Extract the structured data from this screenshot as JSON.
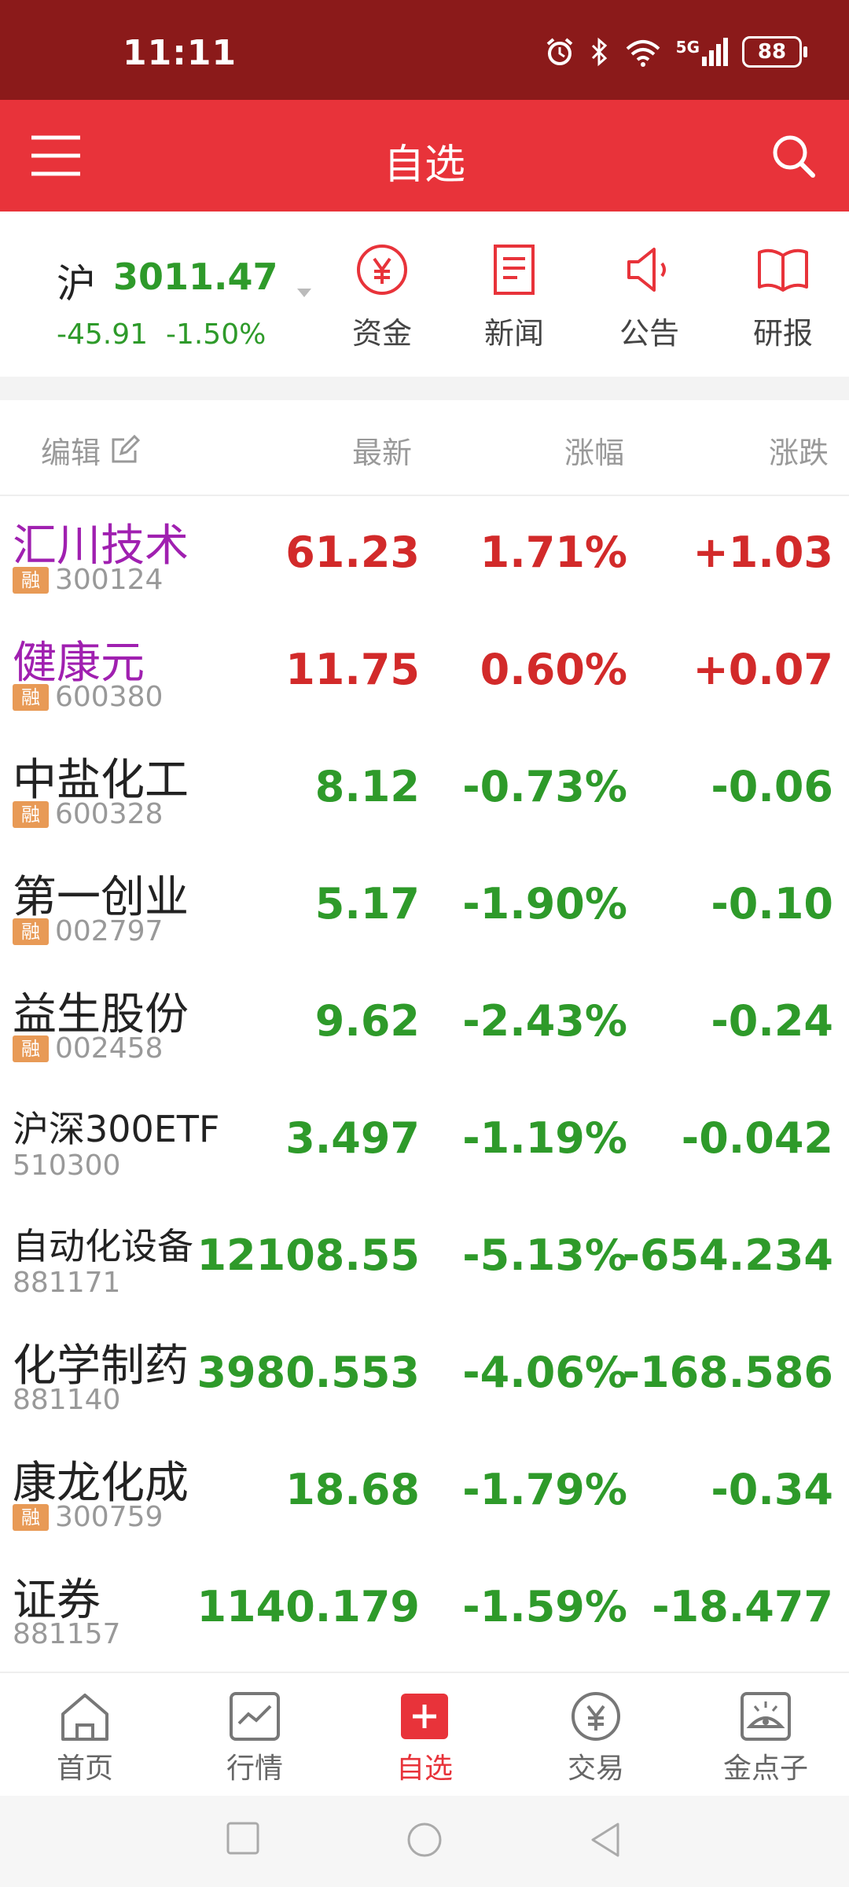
{
  "status_bar": {
    "time": "11:11",
    "battery": "88",
    "network": "5G"
  },
  "nav": {
    "title": "自选"
  },
  "index": {
    "name": "沪",
    "value": "3011.47",
    "change": "-45.91",
    "change_pct": "-1.50%"
  },
  "quick_actions": [
    {
      "label": "资金",
      "icon": "yuan-circle-icon"
    },
    {
      "label": "新闻",
      "icon": "document-icon"
    },
    {
      "label": "公告",
      "icon": "megaphone-icon"
    },
    {
      "label": "研报",
      "icon": "book-icon"
    }
  ],
  "list_header": {
    "edit": "编辑",
    "latest": "最新",
    "pct": "涨幅",
    "change": "涨跌"
  },
  "stocks": [
    {
      "name": "汇川技术",
      "code": "300124",
      "badge": "融",
      "latest": "61.23",
      "pct": "1.71%",
      "change": "+1.03",
      "trend": "up",
      "color": "purple"
    },
    {
      "name": "健康元",
      "code": "600380",
      "badge": "融",
      "latest": "11.75",
      "pct": "0.60%",
      "change": "+0.07",
      "trend": "up",
      "color": "purple"
    },
    {
      "name": "中盐化工",
      "code": "600328",
      "badge": "融",
      "latest": "8.12",
      "pct": "-0.73%",
      "change": "-0.06",
      "trend": "down",
      "color": "normal"
    },
    {
      "name": "第一创业",
      "code": "002797",
      "badge": "融",
      "latest": "5.17",
      "pct": "-1.90%",
      "change": "-0.10",
      "trend": "down",
      "color": "normal"
    },
    {
      "name": "益生股份",
      "code": "002458",
      "badge": "融",
      "latest": "9.62",
      "pct": "-2.43%",
      "change": "-0.24",
      "trend": "down",
      "color": "normal"
    },
    {
      "name": "沪深300ETF",
      "code": "510300",
      "badge": "",
      "latest": "3.497",
      "pct": "-1.19%",
      "change": "-0.042",
      "trend": "down",
      "color": "small"
    },
    {
      "name": "自动化设备",
      "code": "881171",
      "badge": "",
      "latest": "12108.55",
      "pct": "-5.13%",
      "change": "-654.234",
      "trend": "down",
      "color": "small"
    },
    {
      "name": "化学制药",
      "code": "881140",
      "badge": "",
      "latest": "3980.553",
      "pct": "-4.06%",
      "change": "-168.586",
      "trend": "down",
      "color": "normal"
    },
    {
      "name": "康龙化成",
      "code": "300759",
      "badge": "融",
      "latest": "18.68",
      "pct": "-1.79%",
      "change": "-0.34",
      "trend": "down",
      "color": "normal"
    },
    {
      "name": "证券",
      "code": "881157",
      "badge": "",
      "latest": "1140.179",
      "pct": "-1.59%",
      "change": "-18.477",
      "trend": "down",
      "color": "normal"
    }
  ],
  "tabs": [
    {
      "label": "首页",
      "icon": "home-icon"
    },
    {
      "label": "行情",
      "icon": "chart-icon"
    },
    {
      "label": "自选",
      "icon": "plus-square-icon",
      "active": true
    },
    {
      "label": "交易",
      "icon": "yuan-circle-icon"
    },
    {
      "label": "金点子",
      "icon": "idea-icon"
    }
  ],
  "colors": {
    "brand_red": "#e8333a",
    "status_bar": "#8b1a1a",
    "up": "#d22a2a",
    "down": "#2e9a2a",
    "highlight_name": "#a020b0",
    "badge": "#e89a56"
  }
}
